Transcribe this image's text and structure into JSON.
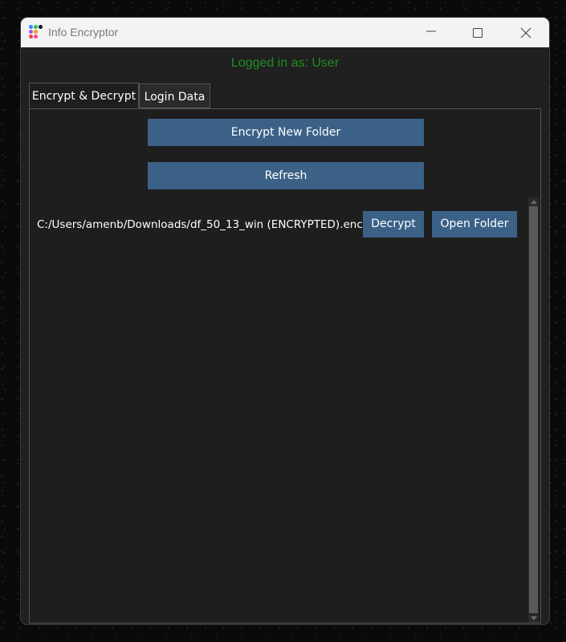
{
  "window": {
    "title": "Info Encryptor",
    "app_icon": "app-icon"
  },
  "status": {
    "logged_in_text": "Logged in as: User",
    "color": "#1f8f1f"
  },
  "tabs": [
    {
      "label": "Encrypt & Decrypt",
      "active": true
    },
    {
      "label": "Login Data",
      "active": false
    }
  ],
  "actions": {
    "encrypt_label": "Encrypt New Folder",
    "refresh_label": "Refresh"
  },
  "files": [
    {
      "path": "C:/Users/amenb/Downloads/df_50_13_win (ENCRYPTED).enc",
      "decrypt_label": "Decrypt",
      "open_label": "Open Folder"
    }
  ],
  "colors": {
    "accent": "#3b6187",
    "background": "#202020"
  }
}
